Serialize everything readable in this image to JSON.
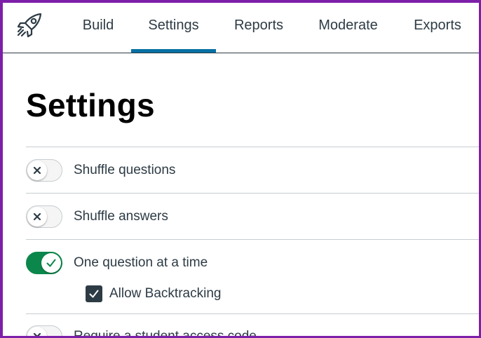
{
  "nav": {
    "tabs": [
      {
        "label": "Build",
        "active": false
      },
      {
        "label": "Settings",
        "active": true
      },
      {
        "label": "Reports",
        "active": false
      },
      {
        "label": "Moderate",
        "active": false
      },
      {
        "label": "Exports",
        "active": false
      }
    ],
    "active_color": "#0770a3"
  },
  "page": {
    "title": "Settings"
  },
  "settings": [
    {
      "label": "Shuffle questions",
      "enabled": false
    },
    {
      "label": "Shuffle answers",
      "enabled": false
    },
    {
      "label": "One question at a time",
      "enabled": true,
      "sub_option": {
        "label": "Allow Backtracking",
        "checked": true
      }
    },
    {
      "label": "Require a student access code",
      "enabled": false
    }
  ],
  "colors": {
    "toggle_on": "#0b874b",
    "toggle_off": "#f5f5f5",
    "text": "#2d3b45",
    "frame": "#7d1fa8"
  }
}
